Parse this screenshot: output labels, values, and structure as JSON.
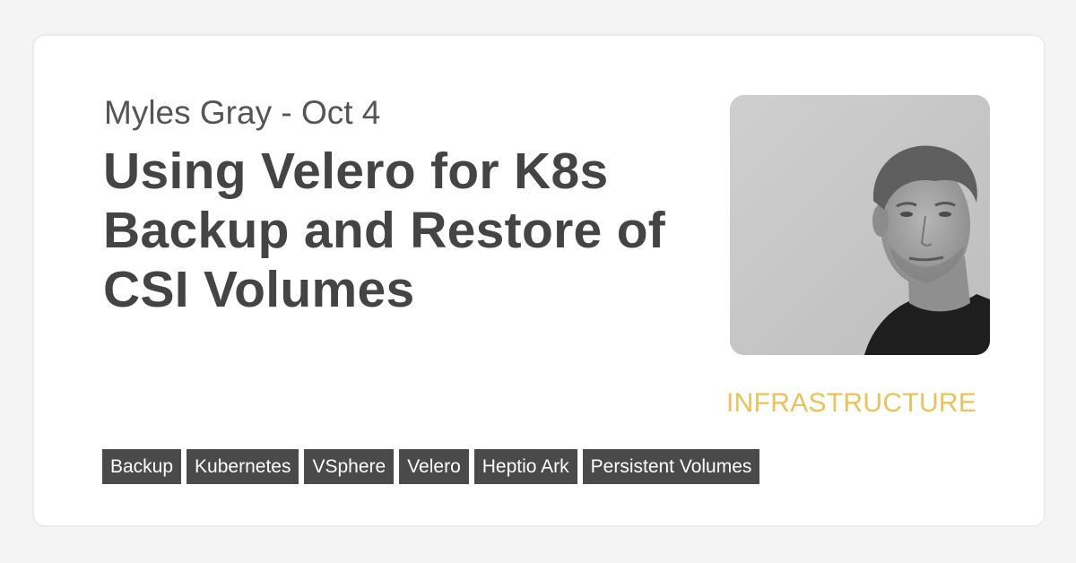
{
  "post": {
    "meta": "Myles Gray - Oct 4",
    "title": "Using Velero for K8s Backup and Restore of CSI Volumes",
    "category": "INFRASTRUCTURE",
    "tags": [
      "Backup",
      "Kubernetes",
      "VSphere",
      "Velero",
      "Heptio Ark",
      "Persistent Volumes"
    ]
  },
  "colors": {
    "background": "#f4f4f4",
    "card": "#ffffff",
    "text": "#444444",
    "meta_text": "#555555",
    "category": "#e8c35a",
    "tag_background": "#4a4a4a",
    "tag_text": "#ffffff"
  },
  "icons": {
    "author_photo": "author-photo"
  }
}
